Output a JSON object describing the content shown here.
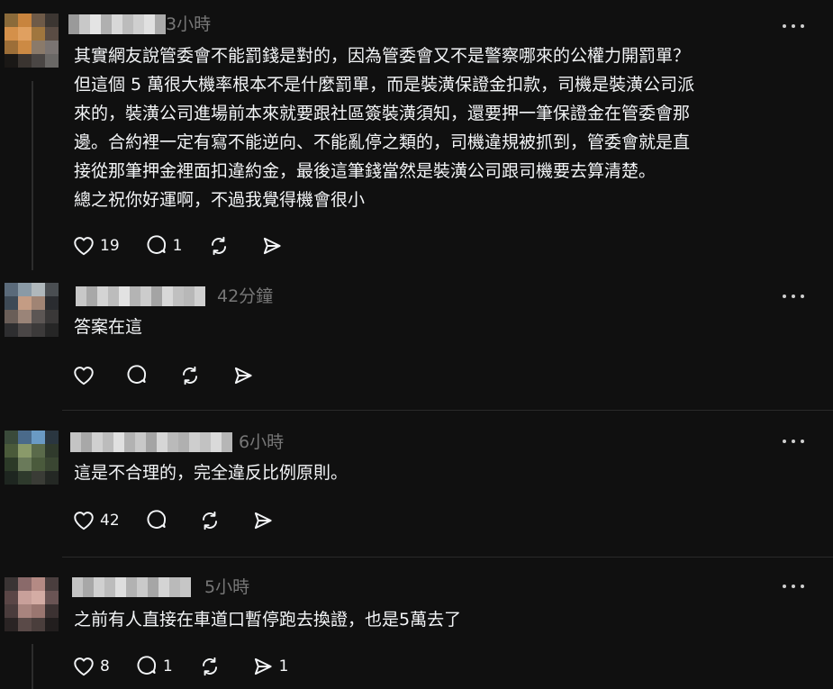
{
  "posts": [
    {
      "timestamp": "3小時",
      "lines": [
        "其實網友說管委會不能罰錢是對的，因為管委會又不是警察哪來的公權力開罰單？",
        "但這個 5 萬很大機率根本不是什麼罰單，而是裝潢保證金扣款，司機是裝潢公司派",
        "來的，裝潢公司進場前本來就要跟社區簽裝潢須知，還要押一筆保證金在管委會那",
        "邊。合約裡一定有寫不能逆向、不能亂停之類的，司機違規被抓到，管委會就是直",
        "接從那筆押金裡面扣違約金，最後這筆錢當然是裝潢公司跟司機要去算清楚。",
        "總之祝你好運啊，不過我覺得機會很小"
      ],
      "likes": "19",
      "replies": "1",
      "reposts": "",
      "shares": ""
    },
    {
      "timestamp": "42分鐘",
      "lines": [
        "答案在這"
      ],
      "likes": "",
      "replies": "",
      "reposts": "",
      "shares": ""
    },
    {
      "timestamp": "6小時",
      "lines": [
        "這是不合理的，完全違反比例原則。"
      ],
      "likes": "42",
      "replies": "",
      "reposts": "",
      "shares": ""
    },
    {
      "timestamp": "5小時",
      "lines": [
        "之前有人直接在車道口暫停跑去換證，也是5萬去了"
      ],
      "likes": "8",
      "replies": "1",
      "reposts": "",
      "shares": "1"
    }
  ],
  "icons": {
    "like": "heart-icon",
    "reply": "comment-icon",
    "repost": "repost-icon",
    "share": "send-icon",
    "more": "more-dots-icon"
  },
  "colors": {
    "background": "#101010",
    "text": "#f3f5f7",
    "secondary": "#777777",
    "divider": "#2a2a2a"
  }
}
